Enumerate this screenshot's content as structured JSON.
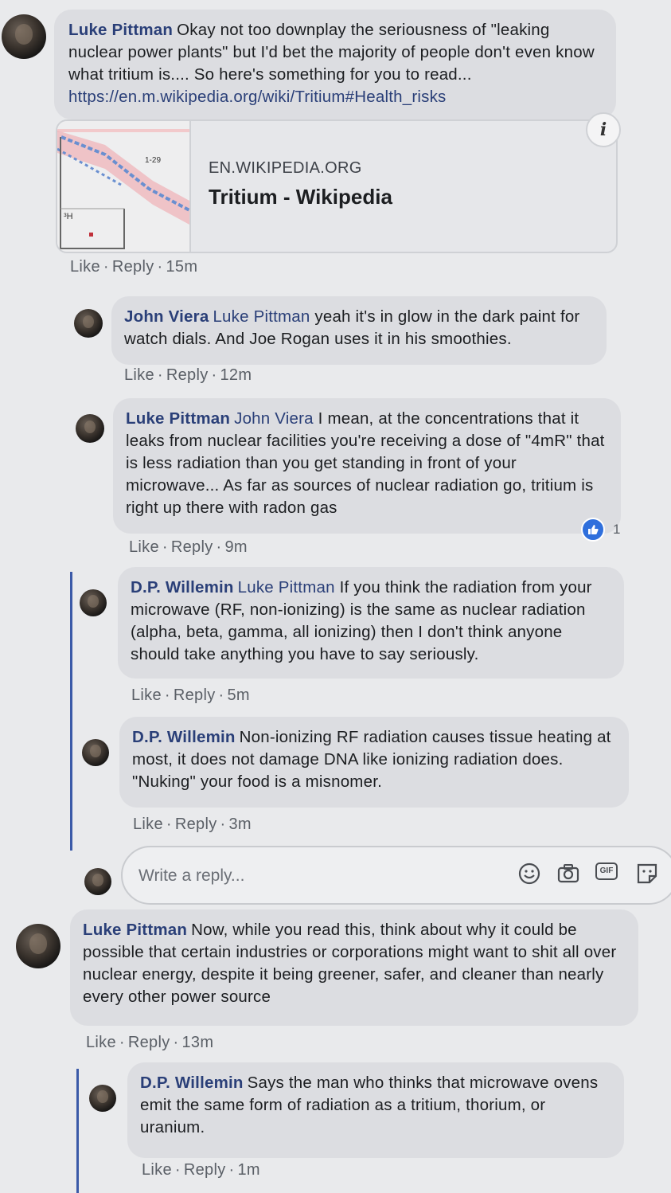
{
  "comments": [
    {
      "author": "Luke Pittman",
      "text": "Okay not too downplay the seriousness of \"leaking nuclear power plants\" but I'd bet the majority of people don't even know what tritium is.... So here's something for you to read...",
      "link": "https://en.m.wikipedia.org/wiki/Tritium#Health_risks",
      "preview": {
        "domain": "EN.WIKIPEDIA.ORG",
        "title": "Tritium - Wikipedia",
        "thumb_label_a": "1-29",
        "thumb_label_b": "³H"
      },
      "like": "Like",
      "reply": "Reply",
      "time": "15m"
    },
    {
      "author": "John Viera",
      "mention": "Luke Pittman",
      "text": "yeah it's in glow in the dark paint for watch dials. And Joe Rogan uses it in his smoothies.",
      "like": "Like",
      "reply": "Reply",
      "time": "12m"
    },
    {
      "author": "Luke Pittman",
      "mention": "John Viera",
      "text": "I mean, at the concentrations that it leaks from nuclear facilities you're receiving a dose of \"4mR\" that is less radiation than you get standing in front of your microwave... As far as sources of nuclear radiation go, tritium is right up there with radon gas",
      "reaction_count": "1",
      "like": "Like",
      "reply": "Reply",
      "time": "9m"
    },
    {
      "author": "D.P. Willemin",
      "mention": "Luke Pittman",
      "text": "If you think the radiation from your microwave (RF, non-ionizing) is the same as nuclear radiation (alpha, beta, gamma, all ionizing) then I don't think anyone should take anything you have to say seriously.",
      "like": "Like",
      "reply": "Reply",
      "time": "5m"
    },
    {
      "author": "D.P. Willemin",
      "text": "Non-ionizing RF radiation causes tissue heating at most, it does not damage DNA like ionizing radiation does. \"Nuking\" your food is a misnomer.",
      "like": "Like",
      "reply": "Reply",
      "time": "3m"
    },
    {
      "author": "Luke Pittman",
      "text": "Now, while you read this, think about why it could be possible that certain industries or corporations might want to shit all over nuclear energy, despite it being greener, safer, and cleaner than nearly every other power source",
      "like": "Like",
      "reply": "Reply",
      "time": "13m"
    },
    {
      "author": "D.P. Willemin",
      "text": "Says the man who thinks that microwave ovens emit the same form of radiation as a tritium, thorium, or uranium.",
      "like": "Like",
      "reply": "Reply",
      "time": "1m"
    }
  ],
  "reply_box": {
    "placeholder": "Write a reply...",
    "icons": [
      "emoji-icon",
      "camera-icon",
      "gif-icon",
      "sticker-icon"
    ],
    "gif_label": "GIF"
  },
  "colors": {
    "author": "#2a3f78",
    "thread_line": "#3b5aa8",
    "like_reaction": "#2f6fdc"
  }
}
